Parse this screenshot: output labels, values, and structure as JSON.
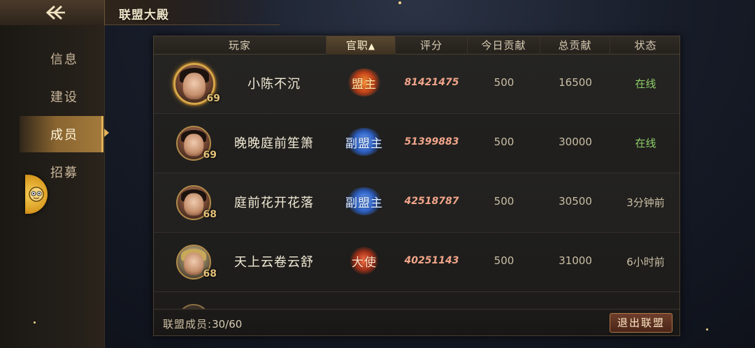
{
  "header": {
    "title": "联盟大殿"
  },
  "sidebar": {
    "items": [
      {
        "label": "信息",
        "active": false
      },
      {
        "label": "建设",
        "active": false
      },
      {
        "label": "成员",
        "active": true
      },
      {
        "label": "招募",
        "active": false
      }
    ]
  },
  "table": {
    "columns": {
      "player": "玩家",
      "rank": "官职",
      "score": "评分",
      "today": "今日贡献",
      "total": "总贡献",
      "status": "状态"
    },
    "sort_indicator": "arrow-up-icon",
    "rows": [
      {
        "name": "小陈不沉",
        "level": "69",
        "rank": "盟主",
        "score": "81421475",
        "today": "500",
        "total": "16500",
        "status": "在线"
      },
      {
        "name": "晚晚庭前笙箫",
        "level": "69",
        "rank": "副盟主",
        "score": "51399883",
        "today": "500",
        "total": "30000",
        "status": "在线"
      },
      {
        "name": "庭前花开花落",
        "level": "68",
        "rank": "副盟主",
        "score": "42518787",
        "today": "500",
        "total": "30500",
        "status": "3分钟前"
      },
      {
        "name": "天上云卷云舒",
        "level": "68",
        "rank": "大使",
        "score": "40251143",
        "today": "500",
        "total": "31000",
        "status": "6小时前"
      }
    ]
  },
  "footer": {
    "member_label": "联盟成员:",
    "member_count": "30/60",
    "quit_label": "退出联盟"
  },
  "colors": {
    "online": "#8fcf6a",
    "score": "#f2a58a",
    "accent_gold": "#e1b259"
  }
}
